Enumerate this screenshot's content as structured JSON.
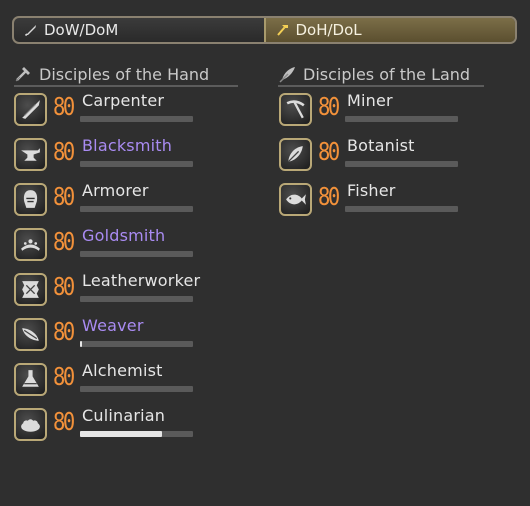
{
  "tabs": [
    {
      "label": "DoW/DoM",
      "icon": "sword-icon",
      "active": false
    },
    {
      "label": "DoH/DoL",
      "icon": "hammer-icon",
      "active": true
    }
  ],
  "hand": {
    "heading": "Disciples of the Hand",
    "jobs": [
      {
        "level": "80",
        "name": "Carpenter",
        "icon": "saw-icon",
        "specialist": false,
        "progress": 0
      },
      {
        "level": "80",
        "name": "Blacksmith",
        "icon": "anvil-icon",
        "specialist": true,
        "progress": 0
      },
      {
        "level": "80",
        "name": "Armorer",
        "icon": "helmet-icon",
        "specialist": false,
        "progress": 0
      },
      {
        "level": "80",
        "name": "Goldsmith",
        "icon": "tiara-icon",
        "specialist": true,
        "progress": 0
      },
      {
        "level": "80",
        "name": "Leatherworker",
        "icon": "hide-icon",
        "specialist": false,
        "progress": 0
      },
      {
        "level": "80",
        "name": "Weaver",
        "icon": "needle-icon",
        "specialist": true,
        "progress": 0.02
      },
      {
        "level": "80",
        "name": "Alchemist",
        "icon": "flask-icon",
        "specialist": false,
        "progress": 0
      },
      {
        "level": "80",
        "name": "Culinarian",
        "icon": "pot-icon",
        "specialist": false,
        "progress": 0.73
      }
    ]
  },
  "land": {
    "heading": "Disciples of the Land",
    "jobs": [
      {
        "level": "80",
        "name": "Miner",
        "icon": "pickaxe-icon",
        "specialist": false,
        "progress": 0
      },
      {
        "level": "80",
        "name": "Botanist",
        "icon": "leaf-icon",
        "specialist": false,
        "progress": 0
      },
      {
        "level": "80",
        "name": "Fisher",
        "icon": "fish-icon",
        "specialist": false,
        "progress": 0
      }
    ]
  },
  "colors": {
    "level": "#f2913a",
    "specialist_name": "#a98bf2",
    "icon_border": "#b9a877",
    "active_tab": "#6b5f3c"
  }
}
